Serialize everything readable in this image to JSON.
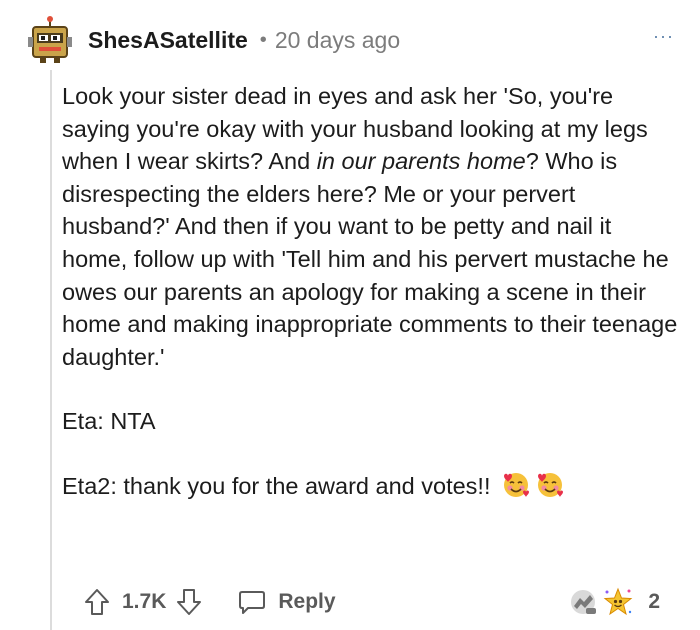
{
  "comment": {
    "username": "ShesASatellite",
    "separator": "•",
    "time": "20 days ago",
    "more_label": "···",
    "paragraph1": {
      "part1": "Look your sister dead in eyes and ask her 'So, you're saying you're okay with your husband looking at my legs when I wear skirts? And ",
      "italic": "in our parents home",
      "part2": "? Who is disrespecting the elders here? Me or your pervert husband?' And then if you want to be petty and nail it home, follow up with 'Tell him and his pervert mustache he owes our parents an apology for making a scene in their home and making inappropriate comments to their teenage daughter.'"
    },
    "paragraph2": "Eta: NTA",
    "paragraph3": "Eta2: thank you for the award and votes!!",
    "emojis": [
      "smiling-face-with-hearts",
      "smiling-face-with-hearts"
    ]
  },
  "actions": {
    "vote_count": "1.7K",
    "reply_label": "Reply",
    "award_count": "2"
  }
}
